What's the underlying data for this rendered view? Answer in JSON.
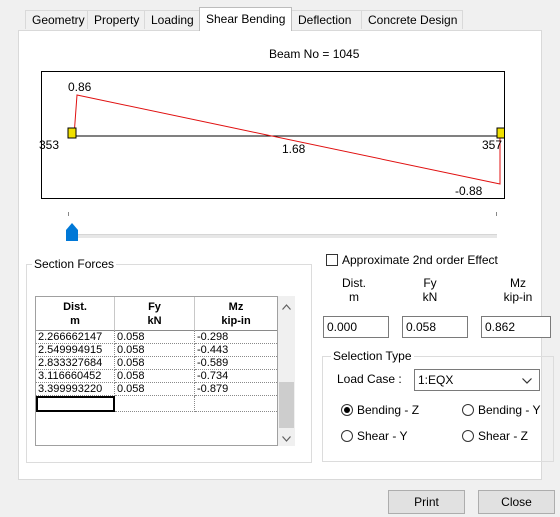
{
  "tabs": [
    {
      "label": "Geometry"
    },
    {
      "label": "Property"
    },
    {
      "label": "Loading"
    },
    {
      "label": "Shear Bending"
    },
    {
      "label": "Deflection"
    },
    {
      "label": "Concrete Design"
    }
  ],
  "active_tab": "Shear Bending",
  "beam_title": "Beam No = 1045",
  "diagram": {
    "start_value": "0.86",
    "mid_value": "1.68",
    "end_value": "-0.88",
    "left_node": "353",
    "right_node": "357",
    "line_color": "#e01010",
    "support_color": "#f0e000"
  },
  "section_forces": {
    "title": "Section Forces",
    "headers": [
      {
        "line1": "Dist.",
        "line2": "m"
      },
      {
        "line1": "Fy",
        "line2": "kN"
      },
      {
        "line1": "Mz",
        "line2": "kip-in"
      }
    ],
    "rows": [
      [
        "2.266662147",
        "0.058",
        "-0.298"
      ],
      [
        "2.549994915",
        "0.058",
        "-0.443"
      ],
      [
        "2.833327684",
        "0.058",
        "-0.589"
      ],
      [
        "3.116660452",
        "0.058",
        "-0.734"
      ],
      [
        "3.399993220",
        "0.058",
        "-0.879"
      ],
      [
        "",
        "",
        ""
      ]
    ]
  },
  "approx_checkbox": {
    "label": "Approximate 2nd order Effect",
    "checked": false
  },
  "values": {
    "dist": {
      "label1": "Dist.",
      "label2": "m",
      "value": "0.000"
    },
    "fy": {
      "label1": "Fy",
      "label2": "kN",
      "value": "0.058"
    },
    "mz": {
      "label1": "Mz",
      "label2": "kip-in",
      "value": "0.862"
    }
  },
  "selection_type": {
    "title": "Selection Type",
    "load_case_label": "Load Case :",
    "load_case_value": "1:EQX",
    "options": {
      "bending_z": "Bending - Z",
      "bending_y": "Bending - Y",
      "shear_y": "Shear - Y",
      "shear_z": "Shear - Z"
    },
    "selected": "bending_z"
  },
  "buttons": {
    "print": "Print",
    "close": "Close"
  }
}
